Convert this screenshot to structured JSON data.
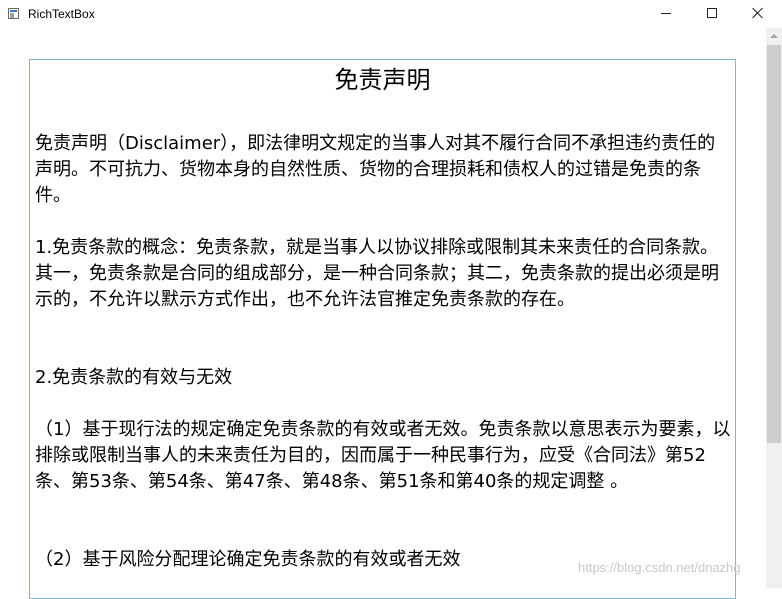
{
  "window": {
    "title": "RichTextBox",
    "icon": "app-window-icon",
    "controls": [
      "minimize-icon",
      "maximize-icon",
      "close-icon"
    ]
  },
  "document": {
    "title": "免责声明",
    "paragraphs": [
      "免责声明（Disclaimer），即法律明文规定的当事人对其不履行合同不承担违约责任的声明。不可抗力、货物本身的自然性质、货物的合理损耗和债权人的过错是免责的条件。",
      "1.免责条款的概念：免责条款，就是当事人以协议排除或限制其未来责任的合同条款。其一，免责条款是合同的组成部分，是一种合同条款；其二，免责条款的提出必须是明示的，不允许以默示方式作出，也不允许法官推定免责条款的存在。",
      "2.免责条款的有效与无效",
      "（1）基于现行法的规定确定免责条款的有效或者无效。免责条款以意思表示为要素，以排除或限制当事人的未来责任为目的，因而属于一种民事行为，应受《合同法》第52条、第53条、第54条、第47条、第48条、第51条和第40条的规定调整 。",
      "（2）基于风险分配理论确定免责条款的有效或者无效"
    ]
  },
  "watermark": "https://blog.csdn.net/dnazhg",
  "colors": {
    "textbox_border": "#7fb9c9",
    "scrollbar_track": "#f0f0f0",
    "scrollbar_thumb": "#cdcdcd"
  }
}
